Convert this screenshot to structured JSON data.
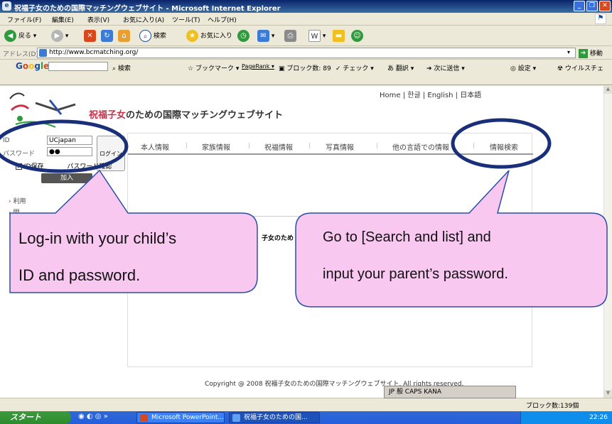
{
  "window": {
    "title": "祝福子女のための国際マッチングウェブサイト - Microsoft Internet Explorer"
  },
  "menu": [
    "ファイル(F)",
    "編集(E)",
    "表示(V)",
    "お気に入り(A)",
    "ツール(T)",
    "ヘルプ(H)"
  ],
  "toolbar": {
    "back_label": "戻る",
    "search_label": "検索",
    "favorites_label": "お気に入り"
  },
  "address": {
    "label": "アドレス(D)",
    "url": "http://www.bcmatching.org/",
    "go_label": "移動"
  },
  "google_bar": {
    "brand": "Google",
    "search_label": "検索",
    "bookmarks_label": "ブックマーク",
    "pagerank_label": "PageRank",
    "blocked_label": "ブロック数: 89",
    "check_label": "チェック",
    "translate_label": "翻訳",
    "send_label": "次に送信",
    "settings_label": "設定",
    "virus_label": "ウイルスチェ"
  },
  "site": {
    "lang_nav": "Home | 한글 | English | 日本語",
    "title_highlight": "祝福子女",
    "title_rest": "のための国際マッチングウェブサイト",
    "login": {
      "id_label": "ID",
      "id_value": "UCjapan",
      "pw_label": "パスワード",
      "pw_value": "●●",
      "login_button": "ログイン",
      "remember_label": "ID保存",
      "pw_check_label": "パスワード確認",
      "join_button": "加入"
    },
    "side_links": [
      "利用",
      "問"
    ],
    "tabs": [
      "本人情報",
      "家族情報",
      "祝福情報",
      "写真情報",
      "他の言語での情報",
      "情報検索"
    ],
    "fragment_text": "子女のため",
    "copyright": "Copyright @ 2008 祝福子女のための国際マッチングウェブサイト. All rights reserved."
  },
  "ime": {
    "label": "JP 般 CAPS KANA"
  },
  "status": {
    "blocked": "ブロック数:139個"
  },
  "taskbar": {
    "start": "スタート",
    "tasks": [
      "Microsoft PowerPoint...",
      "祝福子女のための国..."
    ],
    "clock": "22:26"
  },
  "callouts": {
    "left_line1": "Log-in  with  your  child’s",
    "left_line2": "ID and password.",
    "right_line1": "Go to [Search and list] and",
    "right_line2": "input your parent’s password."
  },
  "colors": {
    "callout_fill": "#f8c8f0",
    "callout_stroke": "#2a4fa8",
    "highlight_ellipse": "#1a2f7a",
    "brand_red": "#c8324a"
  }
}
